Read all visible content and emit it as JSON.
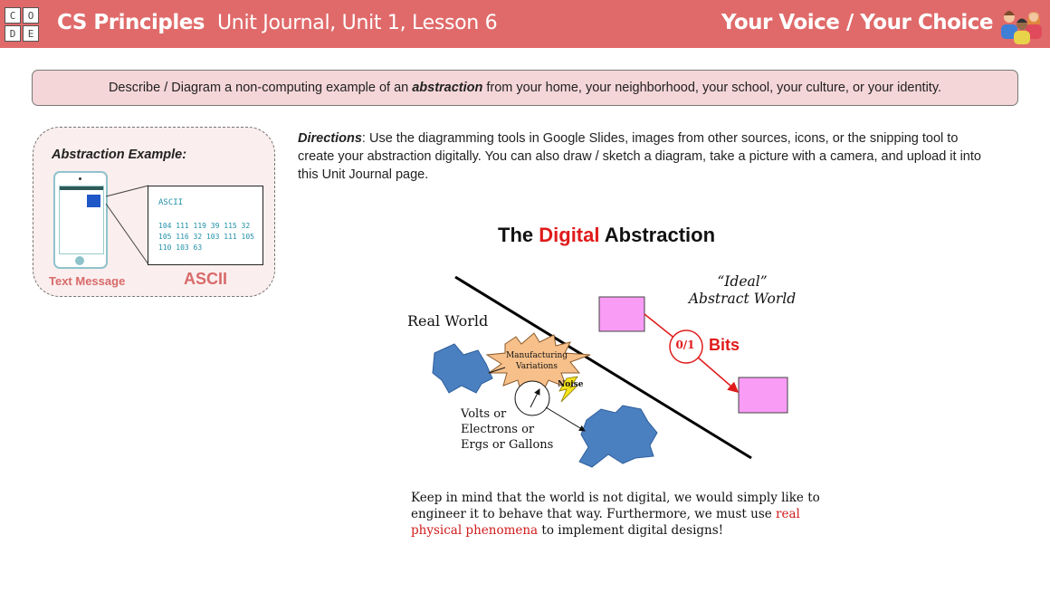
{
  "header": {
    "logo_letters": [
      "C",
      "O",
      "D",
      "E"
    ],
    "course": "CS Principles",
    "unit": "Unit Journal, Unit 1, Lesson 6",
    "choice": "Your Voice / Your Choice",
    "people_icon": "people-group-icon"
  },
  "prompt": {
    "before": "Describe / Diagram a non-computing example of an",
    "emphasis": "abstraction",
    "after": "from your home, your neighborhood, your school, your culture, or your identity."
  },
  "example": {
    "title": "Abstraction Example:",
    "ascii_heading": "ASCII",
    "ascii_codes": "104 111 119 39 115 32 105 116 32 103 111 105 110 103 63",
    "caption_left": "Text Message",
    "caption_right": "ASCII",
    "phone_icon": "smartphone-icon"
  },
  "directions": {
    "label": "Directions",
    "text": ": Use the diagramming tools in Google Slides, images from other sources, icons, or the snipping tool to create your abstraction digitally. You can also draw / sketch a diagram, take a picture with a camera, and upload it into this Unit Journal page."
  },
  "diagram": {
    "title_prefix": "The",
    "title_highlight": "Digital",
    "title_suffix": "Abstraction",
    "real_world": "Real World",
    "ideal_line1": "“Ideal”",
    "ideal_line2": "Abstract World",
    "zero_one": "0/1",
    "bits": "Bits",
    "manufacturing": "Manufacturing Variations",
    "noise": "Noise",
    "volts_line1": "Volts or",
    "volts_line2": "Electrons or",
    "volts_line3": "Ergs or Gallons",
    "colors": {
      "red": "#e01b1b",
      "pink_box": "#f89cf5",
      "blob": "#4a7fc0",
      "burst": "#f7c08a",
      "bolt": "#f5e21a"
    }
  },
  "note": {
    "part1": "Keep in mind that the world is not digital, we would simply like to engineer it to behave that way. Furthermore, we must use",
    "highlight": "real physical phenomena",
    "part2": "to implement digital designs!"
  },
  "colors": {
    "header_bg": "#e06a6a",
    "prompt_bg": "#f5d6d8",
    "card_bg": "#fbeeee",
    "accent": "#d86a6a",
    "ascii_text": "#1f8fa8"
  }
}
